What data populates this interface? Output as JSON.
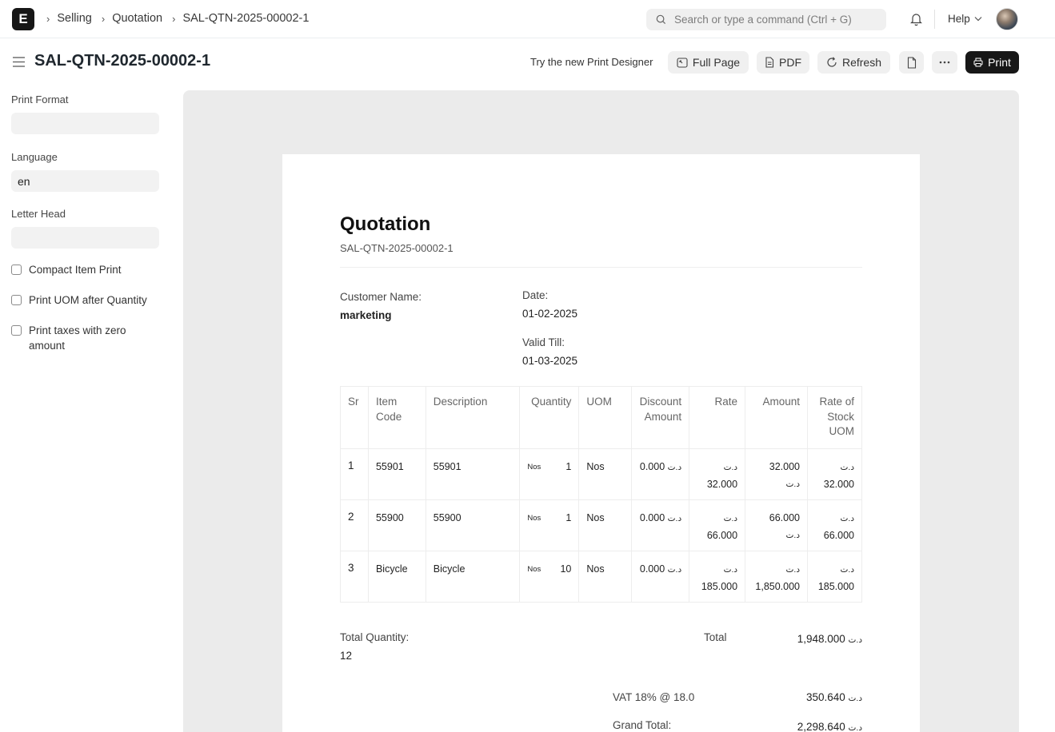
{
  "navbar": {
    "logo": "E",
    "breadcrumbs": [
      "Selling",
      "Quotation",
      "SAL-QTN-2025-00002-1"
    ],
    "search_placeholder": "Search or type a command (Ctrl + G)",
    "help_label": "Help"
  },
  "page": {
    "title": "SAL-QTN-2025-00002-1",
    "print_designer_link": "Try the new Print Designer",
    "buttons": {
      "full_page": "Full Page",
      "pdf": "PDF",
      "refresh": "Refresh",
      "print": "Print"
    }
  },
  "sidebar": {
    "print_format_label": "Print Format",
    "print_format_value": "",
    "language_label": "Language",
    "language_value": "en",
    "letter_head_label": "Letter Head",
    "letter_head_value": "",
    "checkboxes": [
      {
        "label": "Compact Item Print",
        "checked": false
      },
      {
        "label": "Print UOM after Quantity",
        "checked": false
      },
      {
        "label": "Print taxes with zero amount",
        "checked": false
      }
    ]
  },
  "document": {
    "title": "Quotation",
    "name": "SAL-QTN-2025-00002-1",
    "customer_name_label": "Customer Name:",
    "customer_name": "marketing",
    "date_label": "Date:",
    "date": "01-02-2025",
    "valid_till_label": "Valid Till:",
    "valid_till": "01-03-2025",
    "currency": "د.ت",
    "table": {
      "headers": [
        "Sr",
        "Item Code",
        "Description",
        "Quantity",
        "UOM",
        "Discount Amount",
        "Rate",
        "Amount",
        "Rate of Stock UOM"
      ],
      "rows": [
        {
          "sr": "1",
          "item_code": "55901",
          "description": "55901",
          "qty_uom": "Nos",
          "qty": "1",
          "uom": "Nos",
          "discount": "0.000",
          "rate": "32.000",
          "amount": "32.000",
          "rate_stock": "32.000"
        },
        {
          "sr": "2",
          "item_code": "55900",
          "description": "55900",
          "qty_uom": "Nos",
          "qty": "1",
          "uom": "Nos",
          "discount": "0.000",
          "rate": "66.000",
          "amount": "66.000",
          "rate_stock": "66.000"
        },
        {
          "sr": "3",
          "item_code": "Bicycle",
          "description": "Bicycle",
          "qty_uom": "Nos",
          "qty": "10",
          "uom": "Nos",
          "discount": "0.000",
          "rate": "185.000",
          "amount": "1,850.000",
          "rate_stock": "185.000"
        }
      ]
    },
    "total_quantity_label": "Total Quantity:",
    "total_quantity": "12",
    "total_label": "Total",
    "total": "1,948.000",
    "vat_label": "VAT 18% @ 18.0",
    "vat": "350.640",
    "grand_total_label": "Grand Total:",
    "grand_total": "2,298.640"
  }
}
